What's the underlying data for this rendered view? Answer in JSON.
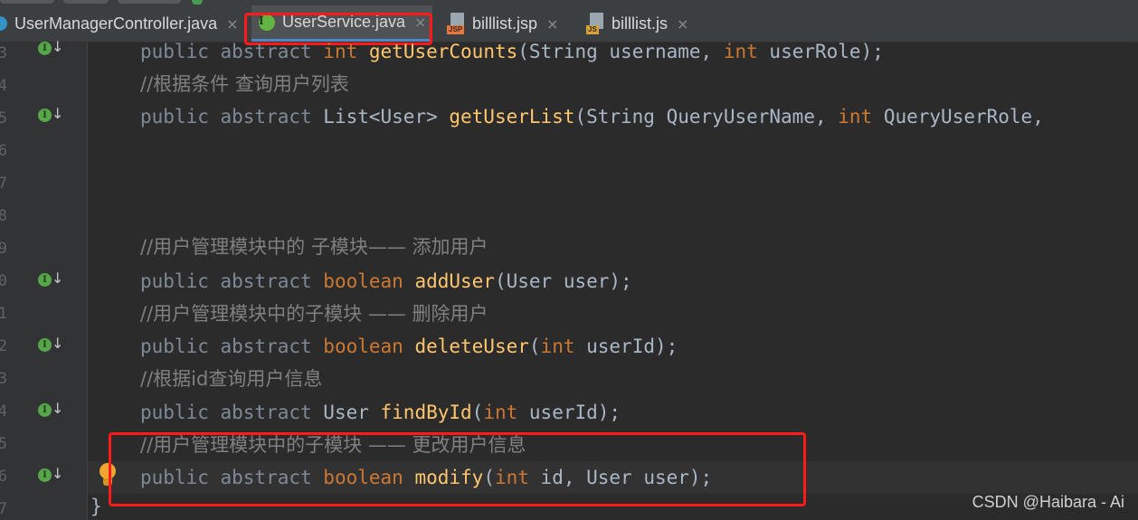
{
  "tabs": [
    {
      "label": "UserManagerController.java",
      "icon": "class-icon",
      "close": "×"
    },
    {
      "label": "UserService.java",
      "icon": "interface-icon",
      "icon_letter": "I",
      "close": "×",
      "active": true
    },
    {
      "label": "billlist.jsp",
      "icon": "jsp-file-icon",
      "badge": "JSP",
      "close": "×"
    },
    {
      "label": "billlist.js",
      "icon": "js-file-icon",
      "badge": "JS",
      "close": "×"
    }
  ],
  "gutter": {
    "line_numbers": [
      "3",
      "4",
      "5",
      "6",
      "7",
      "8",
      "9",
      "0",
      "1",
      "2",
      "3",
      "4",
      "5",
      "6",
      "7"
    ],
    "implemented_marker": "I",
    "arrow": "↓"
  },
  "code": {
    "line1": {
      "mod": "public abstract ",
      "type": "int",
      "fn": "getUserCounts",
      "rest": "(String username, ",
      "kw2": "int",
      "rest2": " userRole);"
    },
    "comment1": "//根据条件 查询用户列表",
    "line2": {
      "mod": "public abstract ",
      "type": "List<User> ",
      "fn": "getUserList",
      "rest": "(String QueryUserName, ",
      "kw2": "int",
      "rest2": " QueryUserRole,"
    },
    "comment2": "//用户管理模块中的 子模块—— 添加用户",
    "line3": {
      "mod": "public abstract ",
      "kw": "boolean ",
      "fn": "addUser",
      "rest": "(User user);"
    },
    "comment3": "//用户管理模块中的子模块 —— 删除用户",
    "line4": {
      "mod": "public abstract ",
      "kw": "boolean ",
      "fn": "deleteUser",
      "rest_open": "(",
      "kw2": "int",
      "rest2": " userId);"
    },
    "comment4": "//根据id查询用户信息",
    "line5": {
      "mod": "public abstract ",
      "type": "User ",
      "fn": "findById",
      "rest_open": "(",
      "kw2": "int",
      "rest2": " userId);"
    },
    "comment5": "//用户管理模块中的子模块 —— 更改用户信息",
    "line6": {
      "mod": "public abstract ",
      "kw": "boolean ",
      "fn": "modify",
      "rest_open": "(",
      "kw2": "int",
      "rest2": " id, User user);"
    },
    "closing_brace": "}"
  },
  "watermark": "CSDN @Haibara - Ai",
  "colors": {
    "highlight": "#ff1a1a",
    "keyword": "#cc7832",
    "method": "#ffc66d",
    "comment": "#808080"
  }
}
